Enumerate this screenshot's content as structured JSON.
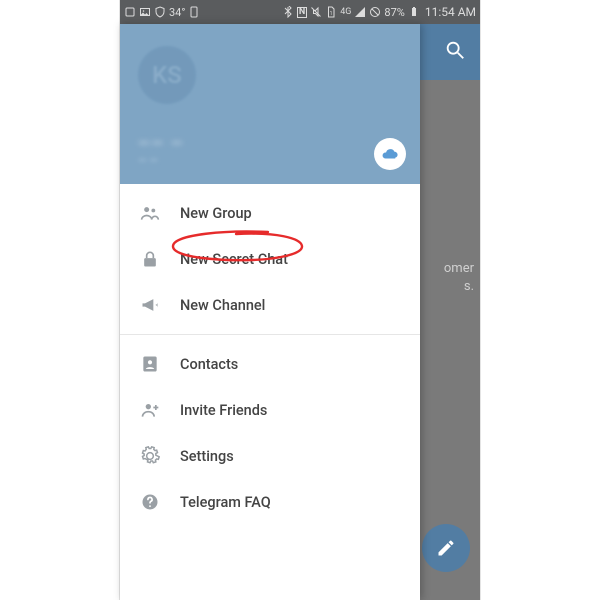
{
  "status": {
    "temp": "34°",
    "network": "4G",
    "battery": "87%",
    "time": "11:54 AM"
  },
  "header": {
    "avatar": "KS",
    "name": "—— —",
    "sub": "— —"
  },
  "menu": {
    "group1": [
      {
        "label": "New Group"
      },
      {
        "label": "New Secret Chat"
      },
      {
        "label": "New Channel"
      }
    ],
    "group2": [
      {
        "label": "Contacts"
      },
      {
        "label": "Invite Friends"
      },
      {
        "label": "Settings"
      },
      {
        "label": "Telegram FAQ"
      }
    ]
  },
  "main": {
    "empty_line1": "omer",
    "empty_line2": "s."
  },
  "annotation": {
    "color": "#e62b2b"
  }
}
